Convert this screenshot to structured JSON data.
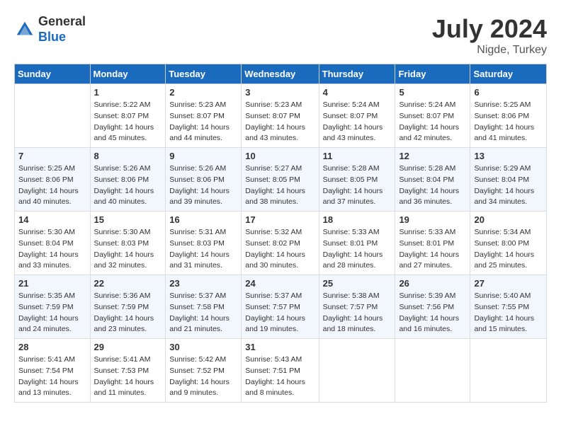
{
  "header": {
    "logo_general": "General",
    "logo_blue": "Blue",
    "month_year": "July 2024",
    "location": "Nigde, Turkey"
  },
  "columns": [
    "Sunday",
    "Monday",
    "Tuesday",
    "Wednesday",
    "Thursday",
    "Friday",
    "Saturday"
  ],
  "weeks": [
    [
      {
        "day": "",
        "info": ""
      },
      {
        "day": "1",
        "info": "Sunrise: 5:22 AM\nSunset: 8:07 PM\nDaylight: 14 hours\nand 45 minutes."
      },
      {
        "day": "2",
        "info": "Sunrise: 5:23 AM\nSunset: 8:07 PM\nDaylight: 14 hours\nand 44 minutes."
      },
      {
        "day": "3",
        "info": "Sunrise: 5:23 AM\nSunset: 8:07 PM\nDaylight: 14 hours\nand 43 minutes."
      },
      {
        "day": "4",
        "info": "Sunrise: 5:24 AM\nSunset: 8:07 PM\nDaylight: 14 hours\nand 43 minutes."
      },
      {
        "day": "5",
        "info": "Sunrise: 5:24 AM\nSunset: 8:07 PM\nDaylight: 14 hours\nand 42 minutes."
      },
      {
        "day": "6",
        "info": "Sunrise: 5:25 AM\nSunset: 8:06 PM\nDaylight: 14 hours\nand 41 minutes."
      }
    ],
    [
      {
        "day": "7",
        "info": "Sunrise: 5:25 AM\nSunset: 8:06 PM\nDaylight: 14 hours\nand 40 minutes."
      },
      {
        "day": "8",
        "info": "Sunrise: 5:26 AM\nSunset: 8:06 PM\nDaylight: 14 hours\nand 40 minutes."
      },
      {
        "day": "9",
        "info": "Sunrise: 5:26 AM\nSunset: 8:06 PM\nDaylight: 14 hours\nand 39 minutes."
      },
      {
        "day": "10",
        "info": "Sunrise: 5:27 AM\nSunset: 8:05 PM\nDaylight: 14 hours\nand 38 minutes."
      },
      {
        "day": "11",
        "info": "Sunrise: 5:28 AM\nSunset: 8:05 PM\nDaylight: 14 hours\nand 37 minutes."
      },
      {
        "day": "12",
        "info": "Sunrise: 5:28 AM\nSunset: 8:04 PM\nDaylight: 14 hours\nand 36 minutes."
      },
      {
        "day": "13",
        "info": "Sunrise: 5:29 AM\nSunset: 8:04 PM\nDaylight: 14 hours\nand 34 minutes."
      }
    ],
    [
      {
        "day": "14",
        "info": "Sunrise: 5:30 AM\nSunset: 8:04 PM\nDaylight: 14 hours\nand 33 minutes."
      },
      {
        "day": "15",
        "info": "Sunrise: 5:30 AM\nSunset: 8:03 PM\nDaylight: 14 hours\nand 32 minutes."
      },
      {
        "day": "16",
        "info": "Sunrise: 5:31 AM\nSunset: 8:03 PM\nDaylight: 14 hours\nand 31 minutes."
      },
      {
        "day": "17",
        "info": "Sunrise: 5:32 AM\nSunset: 8:02 PM\nDaylight: 14 hours\nand 30 minutes."
      },
      {
        "day": "18",
        "info": "Sunrise: 5:33 AM\nSunset: 8:01 PM\nDaylight: 14 hours\nand 28 minutes."
      },
      {
        "day": "19",
        "info": "Sunrise: 5:33 AM\nSunset: 8:01 PM\nDaylight: 14 hours\nand 27 minutes."
      },
      {
        "day": "20",
        "info": "Sunrise: 5:34 AM\nSunset: 8:00 PM\nDaylight: 14 hours\nand 25 minutes."
      }
    ],
    [
      {
        "day": "21",
        "info": "Sunrise: 5:35 AM\nSunset: 7:59 PM\nDaylight: 14 hours\nand 24 minutes."
      },
      {
        "day": "22",
        "info": "Sunrise: 5:36 AM\nSunset: 7:59 PM\nDaylight: 14 hours\nand 23 minutes."
      },
      {
        "day": "23",
        "info": "Sunrise: 5:37 AM\nSunset: 7:58 PM\nDaylight: 14 hours\nand 21 minutes."
      },
      {
        "day": "24",
        "info": "Sunrise: 5:37 AM\nSunset: 7:57 PM\nDaylight: 14 hours\nand 19 minutes."
      },
      {
        "day": "25",
        "info": "Sunrise: 5:38 AM\nSunset: 7:57 PM\nDaylight: 14 hours\nand 18 minutes."
      },
      {
        "day": "26",
        "info": "Sunrise: 5:39 AM\nSunset: 7:56 PM\nDaylight: 14 hours\nand 16 minutes."
      },
      {
        "day": "27",
        "info": "Sunrise: 5:40 AM\nSunset: 7:55 PM\nDaylight: 14 hours\nand 15 minutes."
      }
    ],
    [
      {
        "day": "28",
        "info": "Sunrise: 5:41 AM\nSunset: 7:54 PM\nDaylight: 14 hours\nand 13 minutes."
      },
      {
        "day": "29",
        "info": "Sunrise: 5:41 AM\nSunset: 7:53 PM\nDaylight: 14 hours\nand 11 minutes."
      },
      {
        "day": "30",
        "info": "Sunrise: 5:42 AM\nSunset: 7:52 PM\nDaylight: 14 hours\nand 9 minutes."
      },
      {
        "day": "31",
        "info": "Sunrise: 5:43 AM\nSunset: 7:51 PM\nDaylight: 14 hours\nand 8 minutes."
      },
      {
        "day": "",
        "info": ""
      },
      {
        "day": "",
        "info": ""
      },
      {
        "day": "",
        "info": ""
      }
    ]
  ]
}
